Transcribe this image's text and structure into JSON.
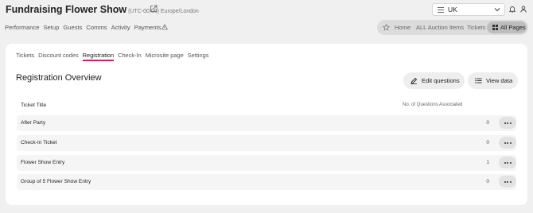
{
  "header": {
    "title": "Fundraising Flower Show",
    "timezone": "(UTC-00:00) Europe/London",
    "region_value": "UK"
  },
  "main_nav": [
    "Performance",
    "Setup",
    "Guests",
    "Comms",
    "Activity",
    "Payments"
  ],
  "pill_nav": {
    "items": [
      "Home",
      "ALL Auction Items",
      "Tickets"
    ],
    "active": "All Pages"
  },
  "tabs": [
    {
      "label": "Tickets",
      "active": false
    },
    {
      "label": "Discount codes",
      "active": false
    },
    {
      "label": "Registration",
      "active": true
    },
    {
      "label": "Check-In",
      "active": false
    },
    {
      "label": "Microsite page",
      "active": false
    },
    {
      "label": "Settings",
      "active": false
    }
  ],
  "main": {
    "heading": "Registration Overview",
    "edit_button": "Edit questions",
    "view_button": "View data",
    "col_title": "Ticket Title",
    "col_count": "No. of Questions Associated"
  },
  "rows": [
    {
      "title": "After Party",
      "count": "0"
    },
    {
      "title": "Check-In Ticket",
      "count": "0"
    },
    {
      "title": "Flower Show Entry",
      "count": "1"
    },
    {
      "title": "Group of 5 Flower Show Entry",
      "count": "0"
    }
  ],
  "colors": {
    "accent": "#cc1f72",
    "page_bg": "#f0f0f0",
    "card_bg": "#ffffff"
  }
}
